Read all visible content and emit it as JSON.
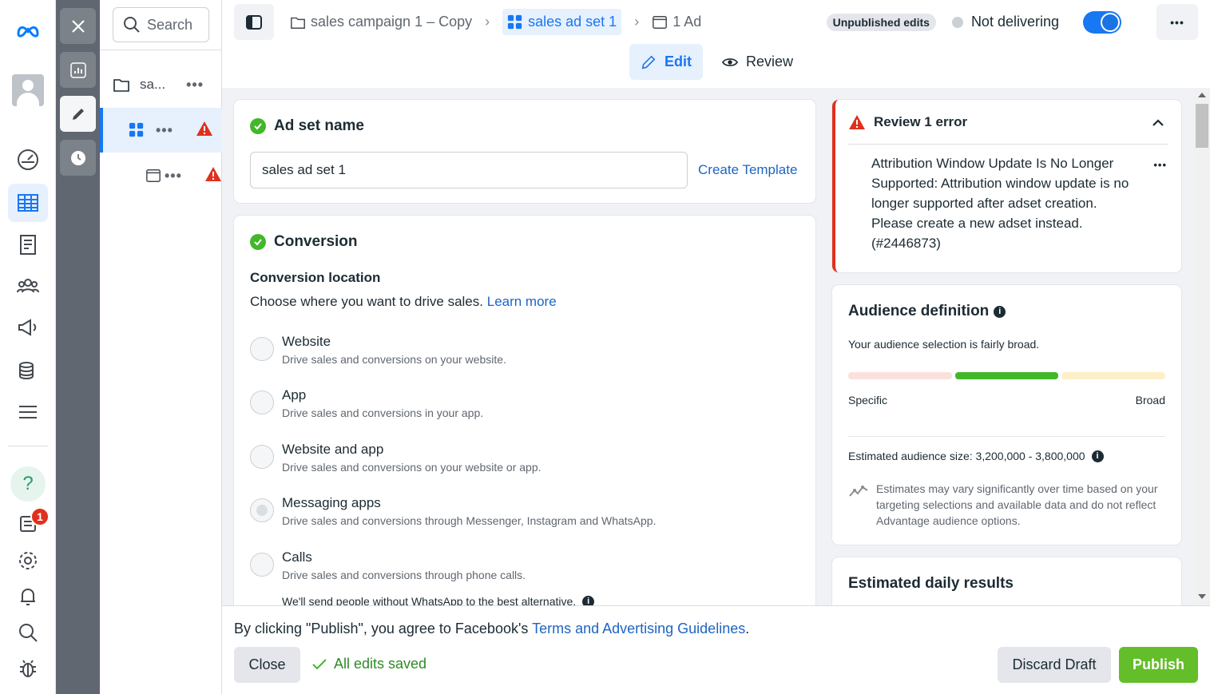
{
  "global_nav": {
    "items": [
      "meta-logo",
      "avatar",
      "dashboard",
      "ads-manager",
      "reports",
      "audiences",
      "campaigns",
      "billing",
      "all-tools",
      "help",
      "notifications",
      "settings",
      "alerts",
      "search",
      "debug"
    ],
    "notification_count": "1"
  },
  "tree": {
    "search_placeholder": "Search",
    "campaign_label": "sa..."
  },
  "header": {
    "breadcrumbs": [
      {
        "label": "sales campaign 1 – Copy"
      },
      {
        "label": "sales ad set 1"
      },
      {
        "label": "1 Ad"
      }
    ],
    "unpublished": "Unpublished edits",
    "status": "Not delivering",
    "tabs": {
      "edit": "Edit",
      "review": "Review"
    }
  },
  "adset_name": {
    "title": "Ad set name",
    "value": "sales ad set 1",
    "template_link": "Create Template"
  },
  "conversion": {
    "title": "Conversion",
    "location_label": "Conversion location",
    "description": "Choose where you want to drive sales.",
    "learn_more": "Learn more",
    "options": [
      {
        "title": "Website",
        "desc": "Drive sales and conversions on your website."
      },
      {
        "title": "App",
        "desc": "Drive sales and conversions in your app."
      },
      {
        "title": "Website and app",
        "desc": "Drive sales and conversions on your website or app."
      },
      {
        "title": "Messaging apps",
        "desc": "Drive sales and conversions through Messenger, Instagram and WhatsApp."
      },
      {
        "title": "Calls",
        "desc": "Drive sales and conversions through phone calls."
      }
    ],
    "whatsapp_note": "We'll send people without WhatsApp to the best alternative."
  },
  "error": {
    "title": "Review 1 error",
    "message": "Attribution Window Update Is No Longer Supported: Attribution window update is no longer supported after adset creation. Please create a new adset instead. (#2446873)"
  },
  "audience": {
    "title": "Audience definition",
    "summary": "Your audience selection is fairly broad.",
    "specific": "Specific",
    "broad": "Broad",
    "size_label": "Estimated audience size: 3,200,000 - 3,800,000",
    "estimate_note": "Estimates may vary significantly over time based on your targeting selections and available data and do not reflect Advantage audience options."
  },
  "daily": {
    "title": "Estimated daily results"
  },
  "footer": {
    "agree_prefix": "By clicking \"Publish\", you agree to Facebook's ",
    "agree_link": "Terms and Advertising Guidelines",
    "agree_suffix": ".",
    "close": "Close",
    "saved": "All edits saved",
    "discard": "Discard Draft",
    "publish": "Publish"
  },
  "colors": {
    "accent": "#1877f2",
    "error": "#e0301e",
    "success": "#42b72a",
    "publish": "#63be29"
  }
}
